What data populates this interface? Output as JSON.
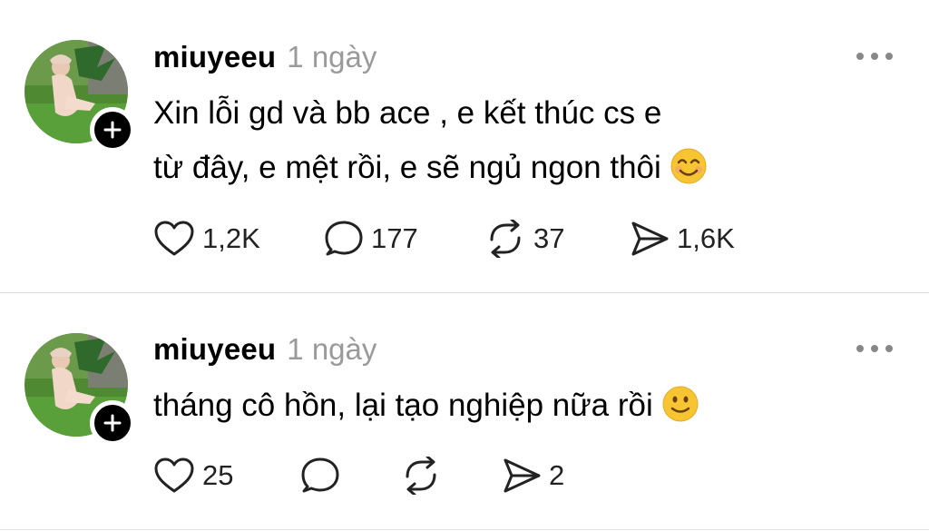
{
  "posts": [
    {
      "username": "miuyeeu",
      "time": "1 ngày",
      "text_lines": [
        "Xin lỗi gd và bb ace , e kết thúc cs e",
        "từ đây, e mệt rồi, e sẽ ngủ ngon thôi"
      ],
      "emoji": "smiling-face-with-smiling-eyes",
      "likes": "1,2K",
      "replies": "177",
      "reposts": "37",
      "shares": "1,6K"
    },
    {
      "username": "miuyeeu",
      "time": "1 ngày",
      "text_lines": [
        "tháng cô hồn, lại tạo nghiệp nữa rồi"
      ],
      "emoji": "slightly-smiling-face",
      "likes": "25",
      "replies": "",
      "reposts": "",
      "shares": "2"
    }
  ],
  "colors": {
    "text": "#000000",
    "muted": "#9a9a9a",
    "divider": "#d9d9d9",
    "emoji": "#f7c531"
  }
}
